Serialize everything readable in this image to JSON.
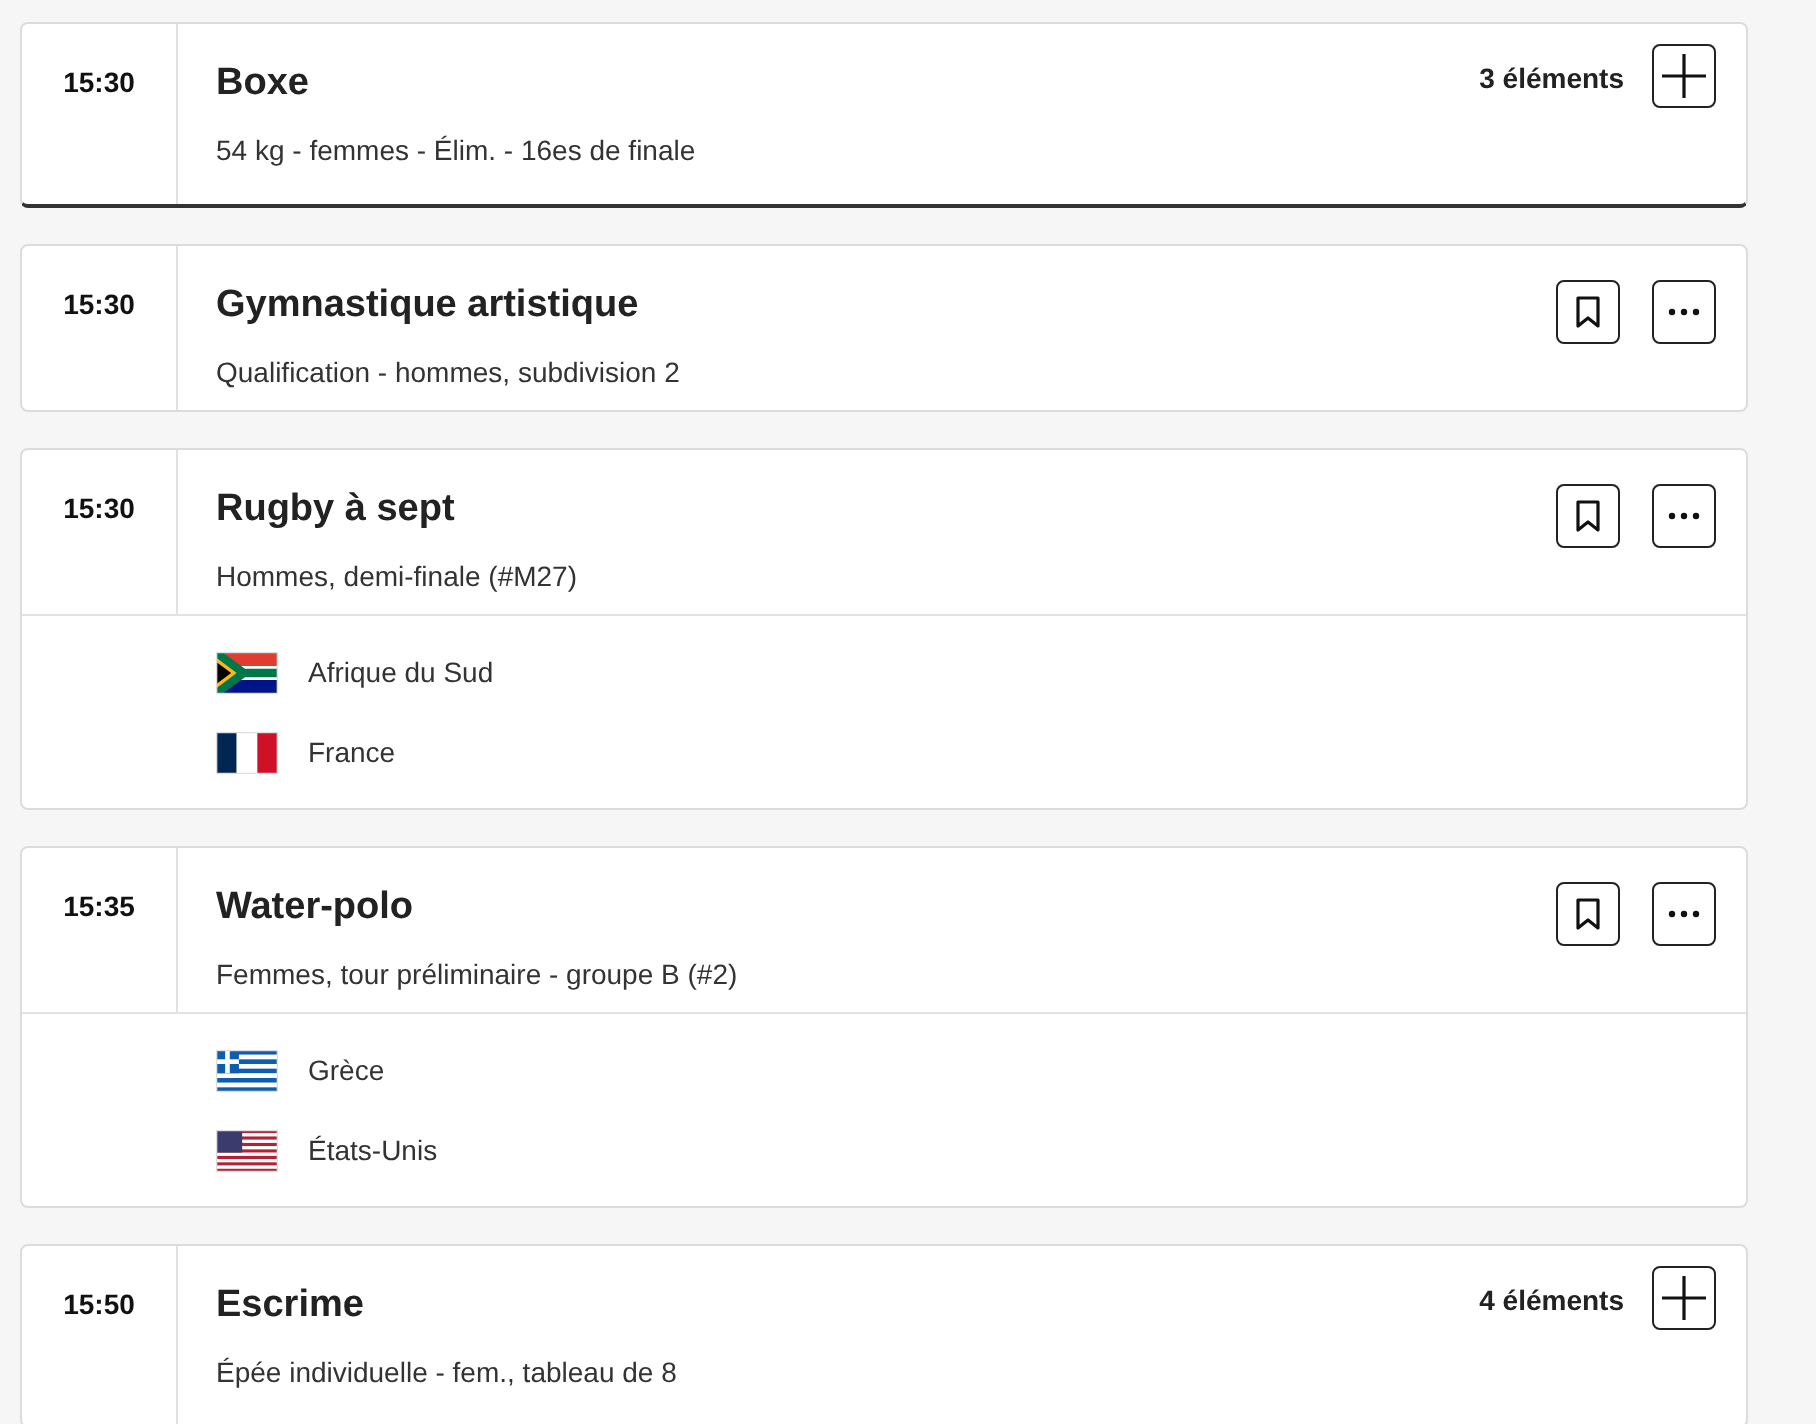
{
  "events": [
    {
      "kind": "group",
      "time": "15:30",
      "title": "Boxe",
      "subtitle": "54 kg - femmes - Élim. - 16es de finale",
      "count": "3 éléments",
      "focused": true
    },
    {
      "kind": "single",
      "time": "15:30",
      "title": "Gymnastique artistique",
      "subtitle": "Qualification - hommes, subdivision 2",
      "focused": false
    },
    {
      "kind": "single",
      "time": "15:30",
      "title": "Rugby à sept",
      "subtitle": "Hommes, demi-finale (#M27)",
      "focused": false,
      "teams": [
        {
          "kind": "za",
          "name": "Afrique du Sud"
        },
        {
          "kind": "fr",
          "name": "France"
        }
      ]
    },
    {
      "kind": "single",
      "time": "15:35",
      "title": "Water-polo",
      "subtitle": "Femmes, tour préliminaire - groupe B (#2)",
      "focused": false,
      "teams": [
        {
          "kind": "gr",
          "name": "Grèce"
        },
        {
          "kind": "us",
          "name": "États-Unis"
        }
      ]
    },
    {
      "kind": "group",
      "time": "15:50",
      "title": "Escrime",
      "subtitle": "Épée individuelle - fem., tableau de 8",
      "count": "4 éléments",
      "focused": false
    }
  ]
}
